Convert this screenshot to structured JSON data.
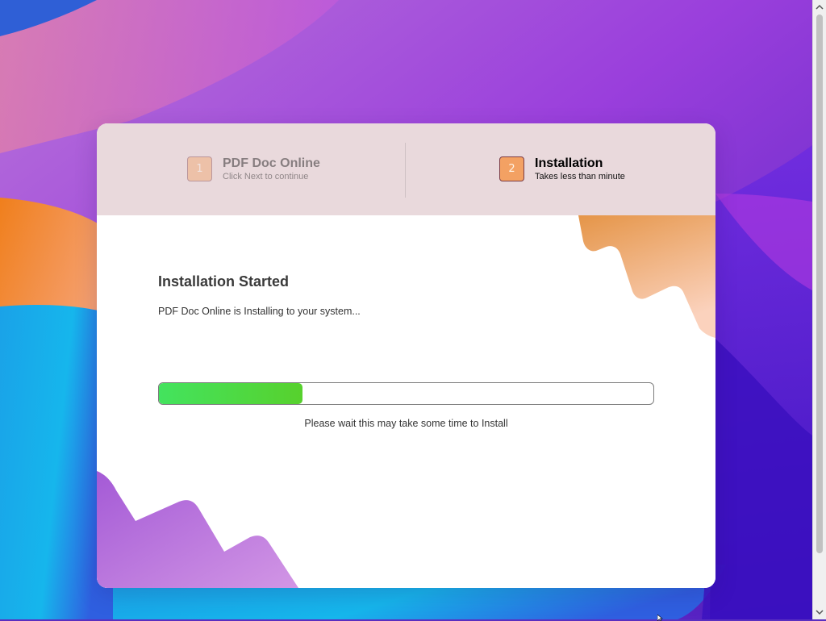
{
  "wizard": {
    "steps": [
      {
        "number": "1",
        "title": "PDF Doc Online",
        "subtitle": "Click Next to continue",
        "state": "inactive"
      },
      {
        "number": "2",
        "title": "Installation",
        "subtitle": "Takes less than minute",
        "state": "active"
      }
    ]
  },
  "content": {
    "title": "Installation Started",
    "subtitle": "PDF Doc Online is Installing to your system...",
    "progress_fraction": 0.29,
    "note": "Please wait this may take some time to Install"
  },
  "colors": {
    "step_badge": "#f3a163",
    "header_bg": "#e9d9dc",
    "progress_start": "#43e35e",
    "progress_end": "#57d12d"
  },
  "icons": {
    "scroll_up": "chevron-up-icon",
    "scroll_down": "chevron-down-icon"
  }
}
